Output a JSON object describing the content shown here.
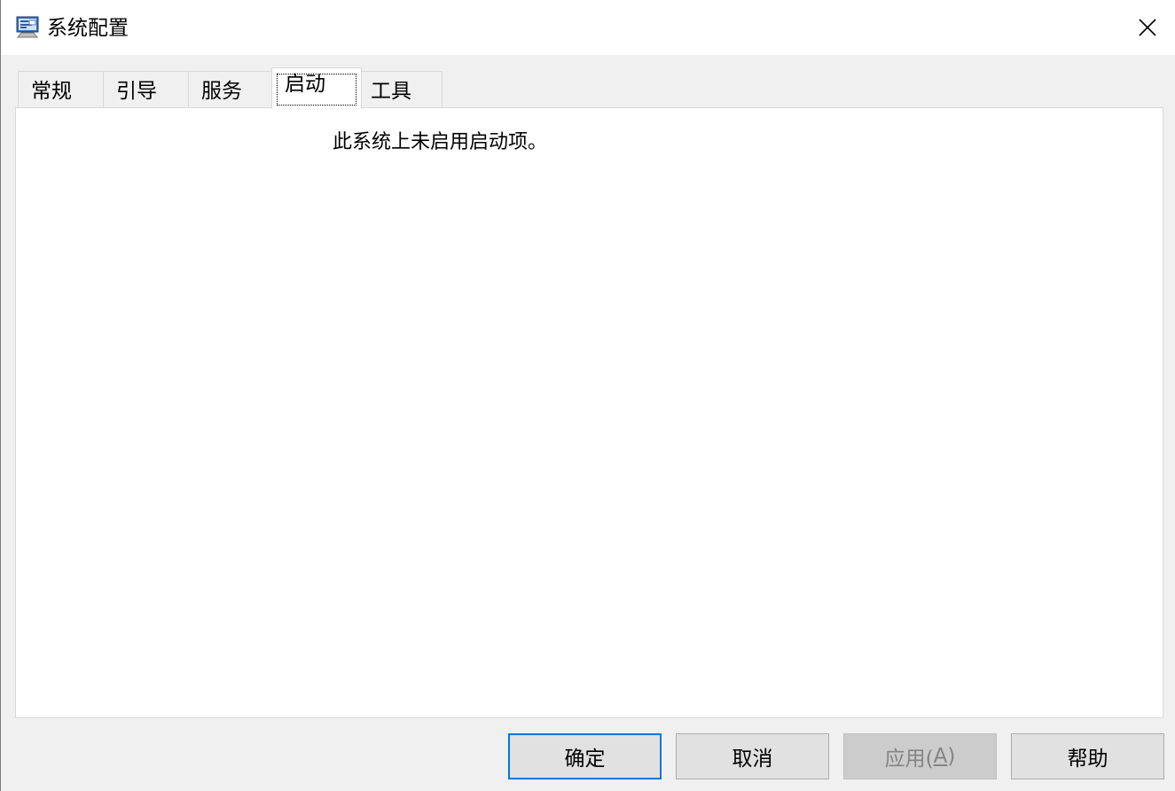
{
  "window": {
    "title": "系统配置",
    "icon": "msconfig-icon"
  },
  "tabs": [
    {
      "label": "常规",
      "active": false
    },
    {
      "label": "引导",
      "active": false
    },
    {
      "label": "服务",
      "active": false
    },
    {
      "label": "启动",
      "active": true
    },
    {
      "label": "工具",
      "active": false
    }
  ],
  "panel": {
    "message": "此系统上未启用启动项。"
  },
  "buttons": {
    "ok": "确定",
    "cancel": "取消",
    "apply_prefix": "应用(",
    "apply_accel": "A",
    "apply_suffix": ")",
    "help": "帮助"
  },
  "colors": {
    "focus_border": "#0078d7",
    "disabled_text": "#838383",
    "dialog_bg": "#f0f0f0"
  }
}
